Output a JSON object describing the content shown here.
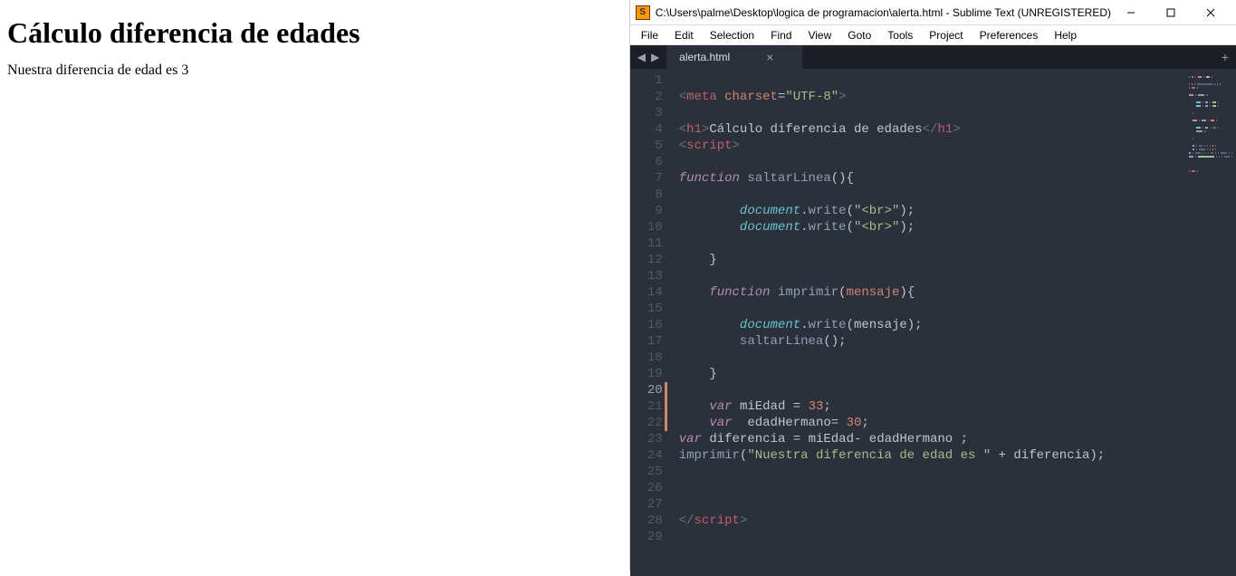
{
  "browser": {
    "heading": "Cálculo diferencia de edades",
    "body_text": "Nuestra diferencia de edad es 3"
  },
  "sublime": {
    "titlebar": "C:\\Users\\palme\\Desktop\\logica de programacion\\alerta.html - Sublime Text (UNREGISTERED)",
    "menu": [
      "File",
      "Edit",
      "Selection",
      "Find",
      "View",
      "Goto",
      "Tools",
      "Project",
      "Preferences",
      "Help"
    ],
    "tab_name": "alerta.html",
    "active_line": 20,
    "edit_marks": [
      20,
      21,
      22
    ],
    "line_count": 29,
    "code_lines": [
      {
        "n": 1,
        "tokens": []
      },
      {
        "n": 2,
        "tokens": [
          {
            "c": "tok-angle",
            "t": "<"
          },
          {
            "c": "tok-tag",
            "t": "meta"
          },
          {
            "c": "",
            "t": " "
          },
          {
            "c": "tok-attr",
            "t": "charset"
          },
          {
            "c": "tok-op",
            "t": "="
          },
          {
            "c": "tok-str",
            "t": "\"UTF-8\""
          },
          {
            "c": "tok-angle",
            "t": ">"
          }
        ]
      },
      {
        "n": 3,
        "tokens": []
      },
      {
        "n": 4,
        "tokens": [
          {
            "c": "tok-angle",
            "t": "<"
          },
          {
            "c": "tok-tag",
            "t": "h1"
          },
          {
            "c": "tok-angle",
            "t": ">"
          },
          {
            "c": "tok-text",
            "t": "Cálculo diferencia de edades"
          },
          {
            "c": "tok-angle",
            "t": "</"
          },
          {
            "c": "tok-tag",
            "t": "h1"
          },
          {
            "c": "tok-angle",
            "t": ">"
          }
        ]
      },
      {
        "n": 5,
        "tokens": [
          {
            "c": "tok-angle",
            "t": "<"
          },
          {
            "c": "tok-tag",
            "t": "script"
          },
          {
            "c": "tok-angle",
            "t": ">"
          }
        ]
      },
      {
        "n": 6,
        "tokens": []
      },
      {
        "n": 7,
        "tokens": [
          {
            "c": "tok-kw-it",
            "t": "function"
          },
          {
            "c": "",
            "t": " "
          },
          {
            "c": "tok-func",
            "t": "saltarLinea"
          },
          {
            "c": "tok-punc",
            "t": "(){"
          }
        ]
      },
      {
        "n": 8,
        "tokens": []
      },
      {
        "n": 9,
        "indent": 2,
        "tokens": [
          {
            "c": "tok-obj",
            "t": "document"
          },
          {
            "c": "tok-punc",
            "t": "."
          },
          {
            "c": "tok-func",
            "t": "write"
          },
          {
            "c": "tok-punc",
            "t": "("
          },
          {
            "c": "tok-str",
            "t": "\"<br>\""
          },
          {
            "c": "tok-punc",
            "t": ");"
          }
        ]
      },
      {
        "n": 10,
        "indent": 2,
        "tokens": [
          {
            "c": "tok-obj",
            "t": "document"
          },
          {
            "c": "tok-punc",
            "t": "."
          },
          {
            "c": "tok-func",
            "t": "write"
          },
          {
            "c": "tok-punc",
            "t": "("
          },
          {
            "c": "tok-str",
            "t": "\"<br>\""
          },
          {
            "c": "tok-punc",
            "t": ");"
          }
        ]
      },
      {
        "n": 11,
        "tokens": []
      },
      {
        "n": 12,
        "indent": 1,
        "tokens": [
          {
            "c": "tok-punc",
            "t": "}"
          }
        ]
      },
      {
        "n": 13,
        "tokens": []
      },
      {
        "n": 14,
        "indent": 1,
        "tokens": [
          {
            "c": "tok-kw-it",
            "t": "function"
          },
          {
            "c": "",
            "t": " "
          },
          {
            "c": "tok-func",
            "t": "imprimir"
          },
          {
            "c": "tok-punc",
            "t": "("
          },
          {
            "c": "tok-param",
            "t": "mensaje"
          },
          {
            "c": "tok-punc",
            "t": "){"
          }
        ]
      },
      {
        "n": 15,
        "tokens": []
      },
      {
        "n": 16,
        "indent": 2,
        "tokens": [
          {
            "c": "tok-obj",
            "t": "document"
          },
          {
            "c": "tok-punc",
            "t": "."
          },
          {
            "c": "tok-func",
            "t": "write"
          },
          {
            "c": "tok-punc",
            "t": "("
          },
          {
            "c": "tok-var",
            "t": "mensaje"
          },
          {
            "c": "tok-punc",
            "t": ");"
          }
        ]
      },
      {
        "n": 17,
        "indent": 2,
        "tokens": [
          {
            "c": "tok-func",
            "t": "saltarLinea"
          },
          {
            "c": "tok-punc",
            "t": "();"
          }
        ]
      },
      {
        "n": 18,
        "tokens": []
      },
      {
        "n": 19,
        "indent": 1,
        "tokens": [
          {
            "c": "tok-punc",
            "t": "}"
          }
        ]
      },
      {
        "n": 20,
        "tokens": []
      },
      {
        "n": 21,
        "indent": 1,
        "tokens": [
          {
            "c": "tok-kw-it",
            "t": "var"
          },
          {
            "c": "",
            "t": " "
          },
          {
            "c": "tok-var",
            "t": "miEdad"
          },
          {
            "c": "",
            "t": " "
          },
          {
            "c": "tok-op",
            "t": "="
          },
          {
            "c": "",
            "t": " "
          },
          {
            "c": "tok-num",
            "t": "33"
          },
          {
            "c": "tok-punc",
            "t": ";"
          }
        ]
      },
      {
        "n": 22,
        "indent": 1,
        "tokens": [
          {
            "c": "tok-kw-it",
            "t": "var"
          },
          {
            "c": "",
            "t": "  "
          },
          {
            "c": "tok-var",
            "t": "edadHermano"
          },
          {
            "c": "tok-op",
            "t": "="
          },
          {
            "c": "",
            "t": " "
          },
          {
            "c": "tok-num",
            "t": "30"
          },
          {
            "c": "tok-punc",
            "t": ";"
          }
        ]
      },
      {
        "n": 23,
        "tokens": [
          {
            "c": "tok-kw-it",
            "t": "var"
          },
          {
            "c": "",
            "t": " "
          },
          {
            "c": "tok-var",
            "t": "diferencia"
          },
          {
            "c": "",
            "t": " "
          },
          {
            "c": "tok-op",
            "t": "="
          },
          {
            "c": "",
            "t": " "
          },
          {
            "c": "tok-var",
            "t": "miEdad"
          },
          {
            "c": "tok-op",
            "t": "-"
          },
          {
            "c": "",
            "t": " "
          },
          {
            "c": "tok-var",
            "t": "edadHermano"
          },
          {
            "c": "",
            "t": " "
          },
          {
            "c": "tok-punc",
            "t": ";"
          }
        ]
      },
      {
        "n": 24,
        "tokens": [
          {
            "c": "tok-func",
            "t": "imprimir"
          },
          {
            "c": "tok-punc",
            "t": "("
          },
          {
            "c": "tok-str",
            "t": "\"Nuestra diferencia de edad es \""
          },
          {
            "c": "",
            "t": " "
          },
          {
            "c": "tok-op",
            "t": "+"
          },
          {
            "c": "",
            "t": " "
          },
          {
            "c": "tok-var",
            "t": "diferencia"
          },
          {
            "c": "tok-punc",
            "t": ");"
          }
        ]
      },
      {
        "n": 25,
        "tokens": []
      },
      {
        "n": 26,
        "tokens": []
      },
      {
        "n": 27,
        "tokens": []
      },
      {
        "n": 28,
        "tokens": [
          {
            "c": "tok-angle",
            "t": "</"
          },
          {
            "c": "tok-tag",
            "t": "script"
          },
          {
            "c": "tok-angle",
            "t": ">"
          }
        ]
      },
      {
        "n": 29,
        "tokens": []
      }
    ]
  }
}
